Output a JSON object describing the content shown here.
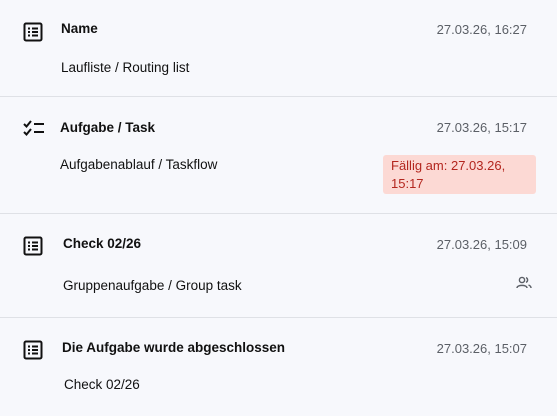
{
  "items": [
    {
      "icon": "list-icon",
      "title": "Name",
      "timestamp": "27.03.26, 16:27",
      "subtitle": "Laufliste / Routing list"
    },
    {
      "icon": "checklist-icon",
      "title": "Aufgabe / Task",
      "timestamp": "27.03.26, 15:17",
      "subtitle": "Aufgabenablauf / Taskflow",
      "due_label": "Fällig am: 27.03.26, 15:17"
    },
    {
      "icon": "list-icon",
      "title": "Check 02/26",
      "timestamp": "27.03.26, 15:09",
      "subtitle": "Gruppenaufgabe / Group task",
      "trailing_icon": "group-icon"
    },
    {
      "icon": "list-icon",
      "title": "Die Aufgabe wurde abgeschlossen",
      "timestamp": "27.03.26, 15:07",
      "subtitle": "Check 02/26"
    }
  ],
  "colors": {
    "background": "#f7f8fc",
    "divider": "#dfe1e6",
    "due_badge_bg": "#fcd9d4",
    "due_badge_text": "#b3261e",
    "timestamp": "#5b5f66"
  }
}
